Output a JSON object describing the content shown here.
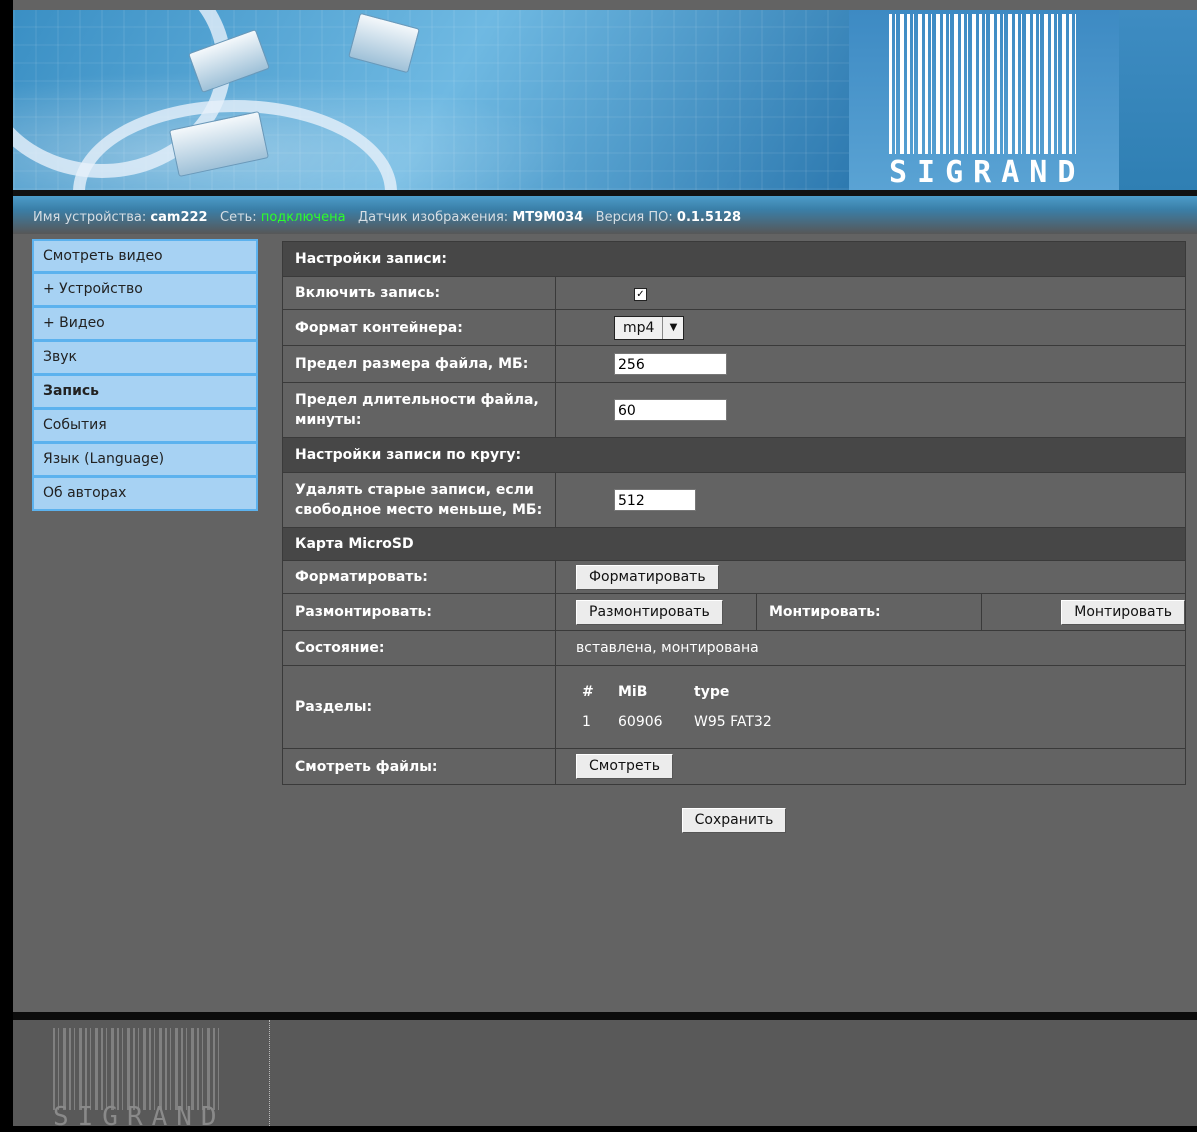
{
  "header": {
    "logo_text": "SIGRAND"
  },
  "status": {
    "device_label": "Имя устройства:",
    "device_value": "cam222",
    "network_label": "Сеть:",
    "network_value": "подключена",
    "sensor_label": "Датчик изображения:",
    "sensor_value": "MT9M034",
    "firmware_label": "Версия ПО:",
    "firmware_value": "0.1.5128",
    "network_color": "#2bff2b"
  },
  "sidebar": {
    "items": [
      {
        "label": "Смотреть видео"
      },
      {
        "label": "+ Устройство"
      },
      {
        "label": "+ Видео"
      },
      {
        "label": "Звук"
      },
      {
        "label": "Запись",
        "active": true
      },
      {
        "label": "События"
      },
      {
        "label": "Язык (Language)"
      },
      {
        "label": "Об авторах"
      }
    ]
  },
  "record": {
    "section_title": "Настройки записи:",
    "enable_label": "Включить запись:",
    "enable_checked": true,
    "container_label": "Формат контейнера:",
    "container_value": "mp4",
    "size_label": "Предел размера файла, МБ:",
    "size_value": "256",
    "duration_label": "Предел длительности файла, минуты:",
    "duration_value": "60"
  },
  "loop": {
    "section_title": "Настройки записи по кругу:",
    "delete_label": "Удалять старые записи, если свободное место меньше, МБ:",
    "delete_value": "512"
  },
  "sdcard": {
    "section_title": "Карта MicroSD",
    "format_label": "Форматировать:",
    "format_button": "Форматировать",
    "unmount_label": "Размонтировать:",
    "unmount_button": "Размонтировать",
    "mount_label": "Монтировать:",
    "mount_button": "Монтировать",
    "state_label": "Состояние:",
    "state_value": "вставлена, монтирована",
    "partitions_label": "Разделы:",
    "partitions_headers": [
      "#",
      "MiB",
      "type"
    ],
    "partitions_rows": [
      [
        "1",
        "60906",
        "W95 FAT32"
      ]
    ],
    "files_label": "Смотреть файлы:",
    "files_button": "Смотреть"
  },
  "save_button": "Сохранить",
  "footer": {
    "logo_text": "SIGRAND"
  }
}
